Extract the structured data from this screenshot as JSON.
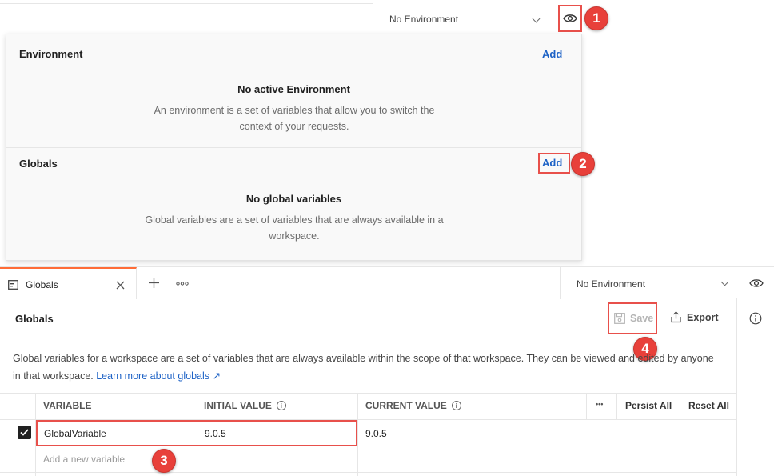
{
  "top_bar": {
    "environment_select": "No Environment"
  },
  "popup": {
    "environment": {
      "title": "Environment",
      "add_label": "Add",
      "empty_title": "No active Environment",
      "empty_desc": "An environment is a set of variables that allow you to switch the context of your requests."
    },
    "globals": {
      "title": "Globals",
      "add_label": "Add",
      "empty_title": "No global variables",
      "empty_desc": "Global variables are a set of variables that are always available in a workspace."
    }
  },
  "badges": [
    "1",
    "2",
    "3",
    "4"
  ],
  "tabs": [
    {
      "label": "Globals",
      "icon": "globals-tab-icon",
      "active": true
    }
  ],
  "tab_bar": {
    "new_tab_icon": "plus-icon",
    "more_icon": "ellipsis-icon",
    "environment_select": "No Environment"
  },
  "editor": {
    "title": "Globals",
    "save_label": "Save",
    "export_label": "Export",
    "description": "Global variables for a workspace are a set of variables that are always available within the scope of that workspace. They can be viewed and edited by anyone in that workspace.",
    "learn_more_label": "Learn more about globals ↗"
  },
  "table": {
    "columns": [
      "VARIABLE",
      "INITIAL VALUE",
      "CURRENT VALUE"
    ],
    "more_label": "•••",
    "persist_all_label": "Persist All",
    "reset_all_label": "Reset All",
    "rows": [
      {
        "checked": true,
        "variable": "GlobalVariable",
        "initial_value": "9.0.5",
        "current_value": "9.0.5"
      }
    ],
    "new_variable_placeholder": "Add a new variable"
  },
  "colors": {
    "accent_orange": "#ff6c37",
    "link_blue": "#1d62c6",
    "annotation_red": "#e8403a"
  }
}
